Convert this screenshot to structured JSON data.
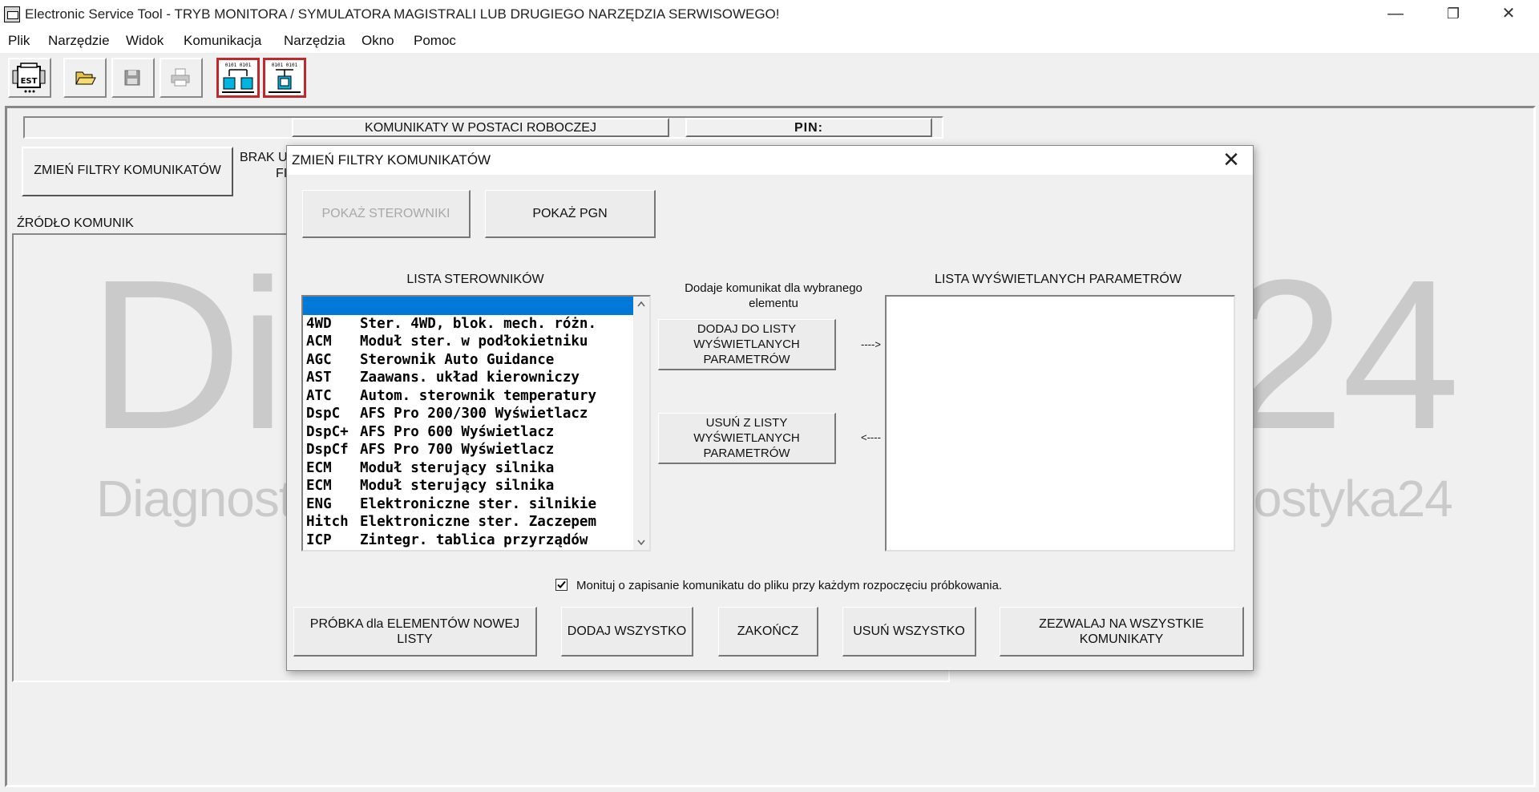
{
  "window": {
    "title": "Electronic Service Tool - TRYB MONITORA / SYMULATORA MAGISTRALI LUB DRUGIEGO NARZĘDZIA SERWISOWEGO!",
    "controls": {
      "minimize": "—",
      "restore": "❐",
      "close": "✕"
    }
  },
  "menu": [
    "Plik",
    "Narzędzie",
    "Widok",
    "Komunikacja",
    "Narzędzia",
    "Okno",
    "Pomoc"
  ],
  "toolbar": {
    "est_label": "EST",
    "buttons": [
      "est-icon",
      "open-folder-icon",
      "save-icon",
      "print-icon",
      "bus-monitor-icon",
      "bus-simulator-icon"
    ]
  },
  "main": {
    "header_label": "KOMUNIKATY W POSTACI ROBOCZEJ",
    "pin_label": "PIN:",
    "change_filters_button": "ZMIEŃ FILTRY KOMUNIKATÓW",
    "status_text_1": "BRAK U",
    "status_text_2": "FI",
    "source_label": "ŹRÓDŁO KOMUNIK"
  },
  "watermark": {
    "large": "Diagnostyka24",
    "small": "Diagnostyka24 Diagnostyka24 Diagnostyka24 Diagnostyka24"
  },
  "dialog": {
    "title": "ZMIEŃ FILTRY KOMUNIKATÓW",
    "close": "✕",
    "show_controllers_button": "POKAŻ STEROWNIKI",
    "show_pgn_button": "POKAŻ PGN",
    "controllers_list_label": "LISTA STEROWNIKÓW",
    "controllers": [
      {
        "code": "",
        "name": ""
      },
      {
        "code": "4WD",
        "name": "Ster. 4WD, blok. mech. różn."
      },
      {
        "code": "ACM",
        "name": "Moduł ster. w podłokietniku"
      },
      {
        "code": "AGC",
        "name": "Sterownik Auto Guidance"
      },
      {
        "code": "AST",
        "name": "Zaawans. układ kierowniczy"
      },
      {
        "code": "ATC",
        "name": "Autom. sterownik temperatury"
      },
      {
        "code": "DspC",
        "name": "AFS Pro 200/300 Wyświetlacz"
      },
      {
        "code": "DspC+",
        "name": "AFS Pro 600 Wyświetlacz"
      },
      {
        "code": "DspCf",
        "name": "AFS Pro 700 Wyświetlacz"
      },
      {
        "code": "ECM",
        "name": "Moduł sterujący silnika"
      },
      {
        "code": "ECM",
        "name": "Moduł sterujący silnika"
      },
      {
        "code": "ENG",
        "name": "Elektroniczne ster. silnikie"
      },
      {
        "code": "Hitch",
        "name": "Elektroniczne ster. Zaczepem"
      },
      {
        "code": "ICP",
        "name": "Zintegr. tablica przyrządów"
      }
    ],
    "add_hint": "Dodaje komunikat dla wybranego elementu",
    "add_button": "DODAJ DO LISTY WYŚWIETLANYCH PARAMETRÓW",
    "add_arrow": "---->",
    "remove_button": "USUŃ Z LISTY WYŚWIETLANYCH PARAMETRÓW",
    "remove_arrow": "<----",
    "params_list_label": "LISTA WYŚWIETLANYCH PARAMETRÓW",
    "checkbox_checked": true,
    "checkbox_label": "Monituj o zapisanie komunikatu do pliku przy każdym rozpoczęciu próbkowania.",
    "sample_button": "PRÓBKA dla ELEMENTÓW NOWEJ LISTY",
    "add_all_button": "DODAJ WSZYSTKO",
    "finish_button": "ZAKOŃCZ",
    "remove_all_button": "USUŃ WSZYSTKO",
    "allow_all_button": "ZEZWALAJ NA WSZYSTKIE KOMUNIKATY"
  },
  "colors": {
    "selection": "#0078d7",
    "toolbar_highlight_border": "#c0282c",
    "network_icon": "#00b4e0"
  }
}
